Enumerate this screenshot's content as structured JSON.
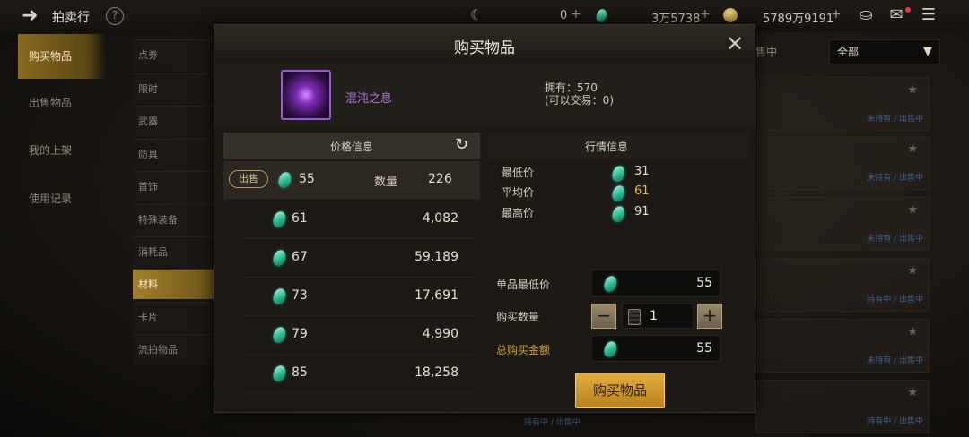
{
  "topbar": {
    "title": "拍卖行",
    "help_icon": "?",
    "currency_a": "0",
    "currency_b": "3万5738",
    "currency_c": "5789万9191",
    "plus": "+"
  },
  "leftnav": {
    "items": [
      {
        "label": "购买物品",
        "active": true
      },
      {
        "label": "出售物品",
        "active": false
      },
      {
        "label": "我的上架",
        "active": false
      },
      {
        "label": "使用记录",
        "active": false
      }
    ]
  },
  "categories": [
    {
      "label": "点券"
    },
    {
      "label": "限时"
    },
    {
      "label": "武器"
    },
    {
      "label": "防具"
    },
    {
      "label": "首饰"
    },
    {
      "label": "特殊装备"
    },
    {
      "label": "消耗品"
    },
    {
      "label": "材料"
    },
    {
      "label": "卡片"
    },
    {
      "label": "流拍物品"
    }
  ],
  "list_header": {
    "filter_tag": "售中",
    "dropdown_value": "全部"
  },
  "list_rows": [
    {
      "status": "未持有 / 出售中"
    },
    {
      "status": "未持有 / 出售中"
    },
    {
      "status": "未持有 / 出售中"
    },
    {
      "status": "持有中 / 出售中"
    },
    {
      "status": "未持有 / 出售中"
    },
    {
      "status": "持有中 / 出售中"
    }
  ],
  "peek_status": "持有中 / 出售中",
  "modal": {
    "title": "购买物品",
    "close": "✕",
    "item": {
      "name": "混沌之息",
      "owned_line1": "拥有：570",
      "owned_line2": "(可以交易：0)"
    },
    "price_panel": {
      "title": "价格信息",
      "sell_label": "出售",
      "sell_price": "55",
      "qty_label": "数量",
      "sell_qty": "226",
      "rows": [
        {
          "price": "61",
          "qty": "4,082"
        },
        {
          "price": "67",
          "qty": "59,189"
        },
        {
          "price": "73",
          "qty": "17,691"
        },
        {
          "price": "79",
          "qty": "4,990"
        },
        {
          "price": "85",
          "qty": "18,258"
        }
      ]
    },
    "market_panel": {
      "title": "行情信息",
      "lowest_label": "最低价",
      "lowest_value": "31",
      "average_label": "平均价",
      "average_value": "61",
      "highest_label": "最高价",
      "highest_value": "91"
    },
    "purchase": {
      "unit_price_label": "单品最低价",
      "unit_price": "55",
      "qty_label": "购买数量",
      "qty": "1",
      "total_label": "总购买金额",
      "total": "55",
      "buy_button": "购买物品",
      "minus": "−",
      "plus": "+"
    }
  },
  "colors": {
    "gold": "#d6a033",
    "average": "#e4b74a",
    "item_name": "#b676e6",
    "gem": "#2cb892"
  }
}
